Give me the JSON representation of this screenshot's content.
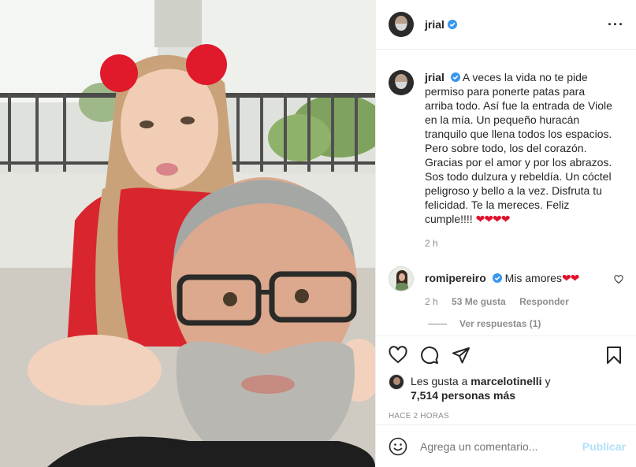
{
  "post": {
    "author": "jrial",
    "verified": true,
    "more_icon": "more-horizontal-icon",
    "caption_text": "A veces la vida no te pide permiso para ponerte patas para arriba todo. Así fue la entrada de Viole en la mía. Un pequeño huracán tranquilo que llena todos los espacios. Pero sobre todo, los del corazón. Gracias por el amor y por los abrazos. Sos todo dulzura y rebeldía. Un cóctel peligroso y bello a la vez. Disfruta tu felicidad. Te la mereces. Feliz cumple!!!!",
    "caption_hearts": "❤❤❤❤",
    "caption_time": "2 h"
  },
  "comment": {
    "author": "romipereiro",
    "verified": true,
    "text": "Mis amores",
    "hearts": "❤❤",
    "time": "2 h",
    "likes": "53 Me gusta",
    "reply": "Responder",
    "view_replies": "Ver respuestas (1)"
  },
  "likes": {
    "prefix": "Les gusta a",
    "user": "marcelotinelli",
    "joiner": "y",
    "others": "7,514 personas más"
  },
  "timeago": "HACE 2 HORAS",
  "add_comment": {
    "placeholder": "Agrega un comentario...",
    "publish": "Publicar"
  },
  "colors": {
    "verified": "#3897f0",
    "heart": "#e0102c",
    "publish_disabled": "#b2dffc",
    "muted": "#8e8e8e"
  }
}
